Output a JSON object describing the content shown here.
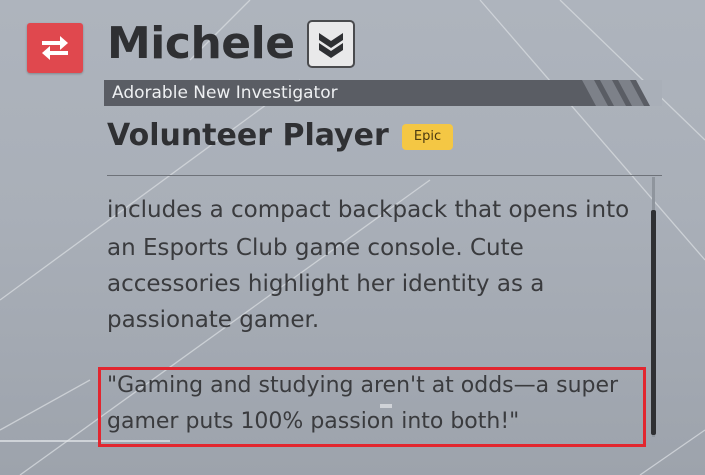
{
  "character": {
    "name": "Michele",
    "subtitle": "Adorable New Investigator",
    "role": "Volunteer Player",
    "rarity": "Epic"
  },
  "description": {
    "lines": [
      "includes a compact backpack that opens into",
      "an Esports Club game console. Cute",
      "accessories highlight her identity as a",
      "passionate gamer."
    ],
    "quote_lines": [
      "\"Gaming and studying aren't at odds—a super",
      "gamer puts 100% passion into both!\""
    ]
  },
  "icons": {
    "swap": "swap-arrows-icon",
    "rank": "double-chevron-rank-icon"
  },
  "colors": {
    "accent_red": "#e0484e",
    "highlight_box": "#e2262f",
    "epic_badge": "#f4c744",
    "text_dark": "#2f3033"
  }
}
